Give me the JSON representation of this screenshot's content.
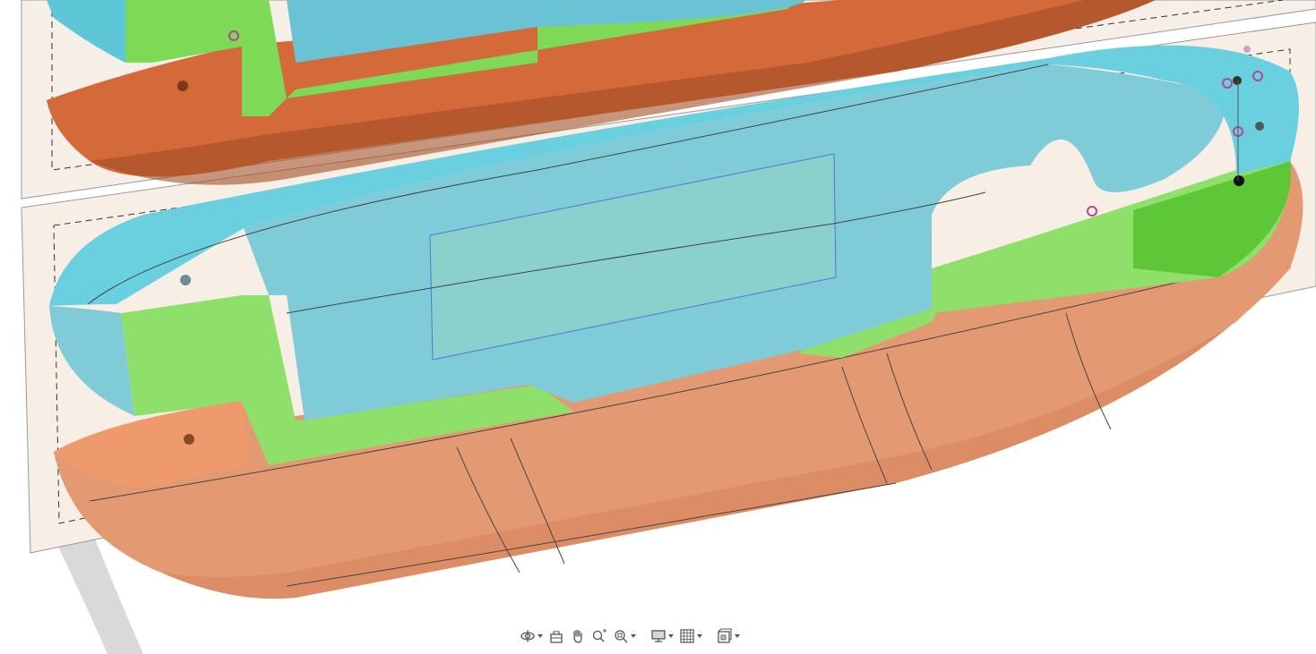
{
  "viewport": {
    "label": "",
    "colors": {
      "body_orange": "#e39a72",
      "body_orange_dark": "#d4693a",
      "cavity_cyan": "#7fcbd8",
      "rim_cyan": "#6ad0e0",
      "green": "#8fe06a",
      "green_dark": "#55c22e",
      "plane": "#f7efe6",
      "sketch_blue": "#4a78d8",
      "constraint_magenta": "#b2479a"
    }
  },
  "toolbar": {
    "items": [
      {
        "name": "orbit",
        "icon": "orbit-icon",
        "has_dropdown": true
      },
      {
        "name": "look-at",
        "icon": "look-at-icon",
        "has_dropdown": false
      },
      {
        "name": "pan",
        "icon": "pan-hand-icon",
        "has_dropdown": false
      },
      {
        "name": "zoom",
        "icon": "zoom-icon",
        "has_dropdown": false
      },
      {
        "name": "fit",
        "icon": "zoom-window-icon",
        "has_dropdown": true
      },
      {
        "name": "display-settings",
        "icon": "display-settings-icon",
        "has_dropdown": true
      },
      {
        "name": "grid-snaps",
        "icon": "grid-icon",
        "has_dropdown": true
      },
      {
        "name": "viewports",
        "icon": "viewports-icon",
        "has_dropdown": true
      }
    ]
  }
}
